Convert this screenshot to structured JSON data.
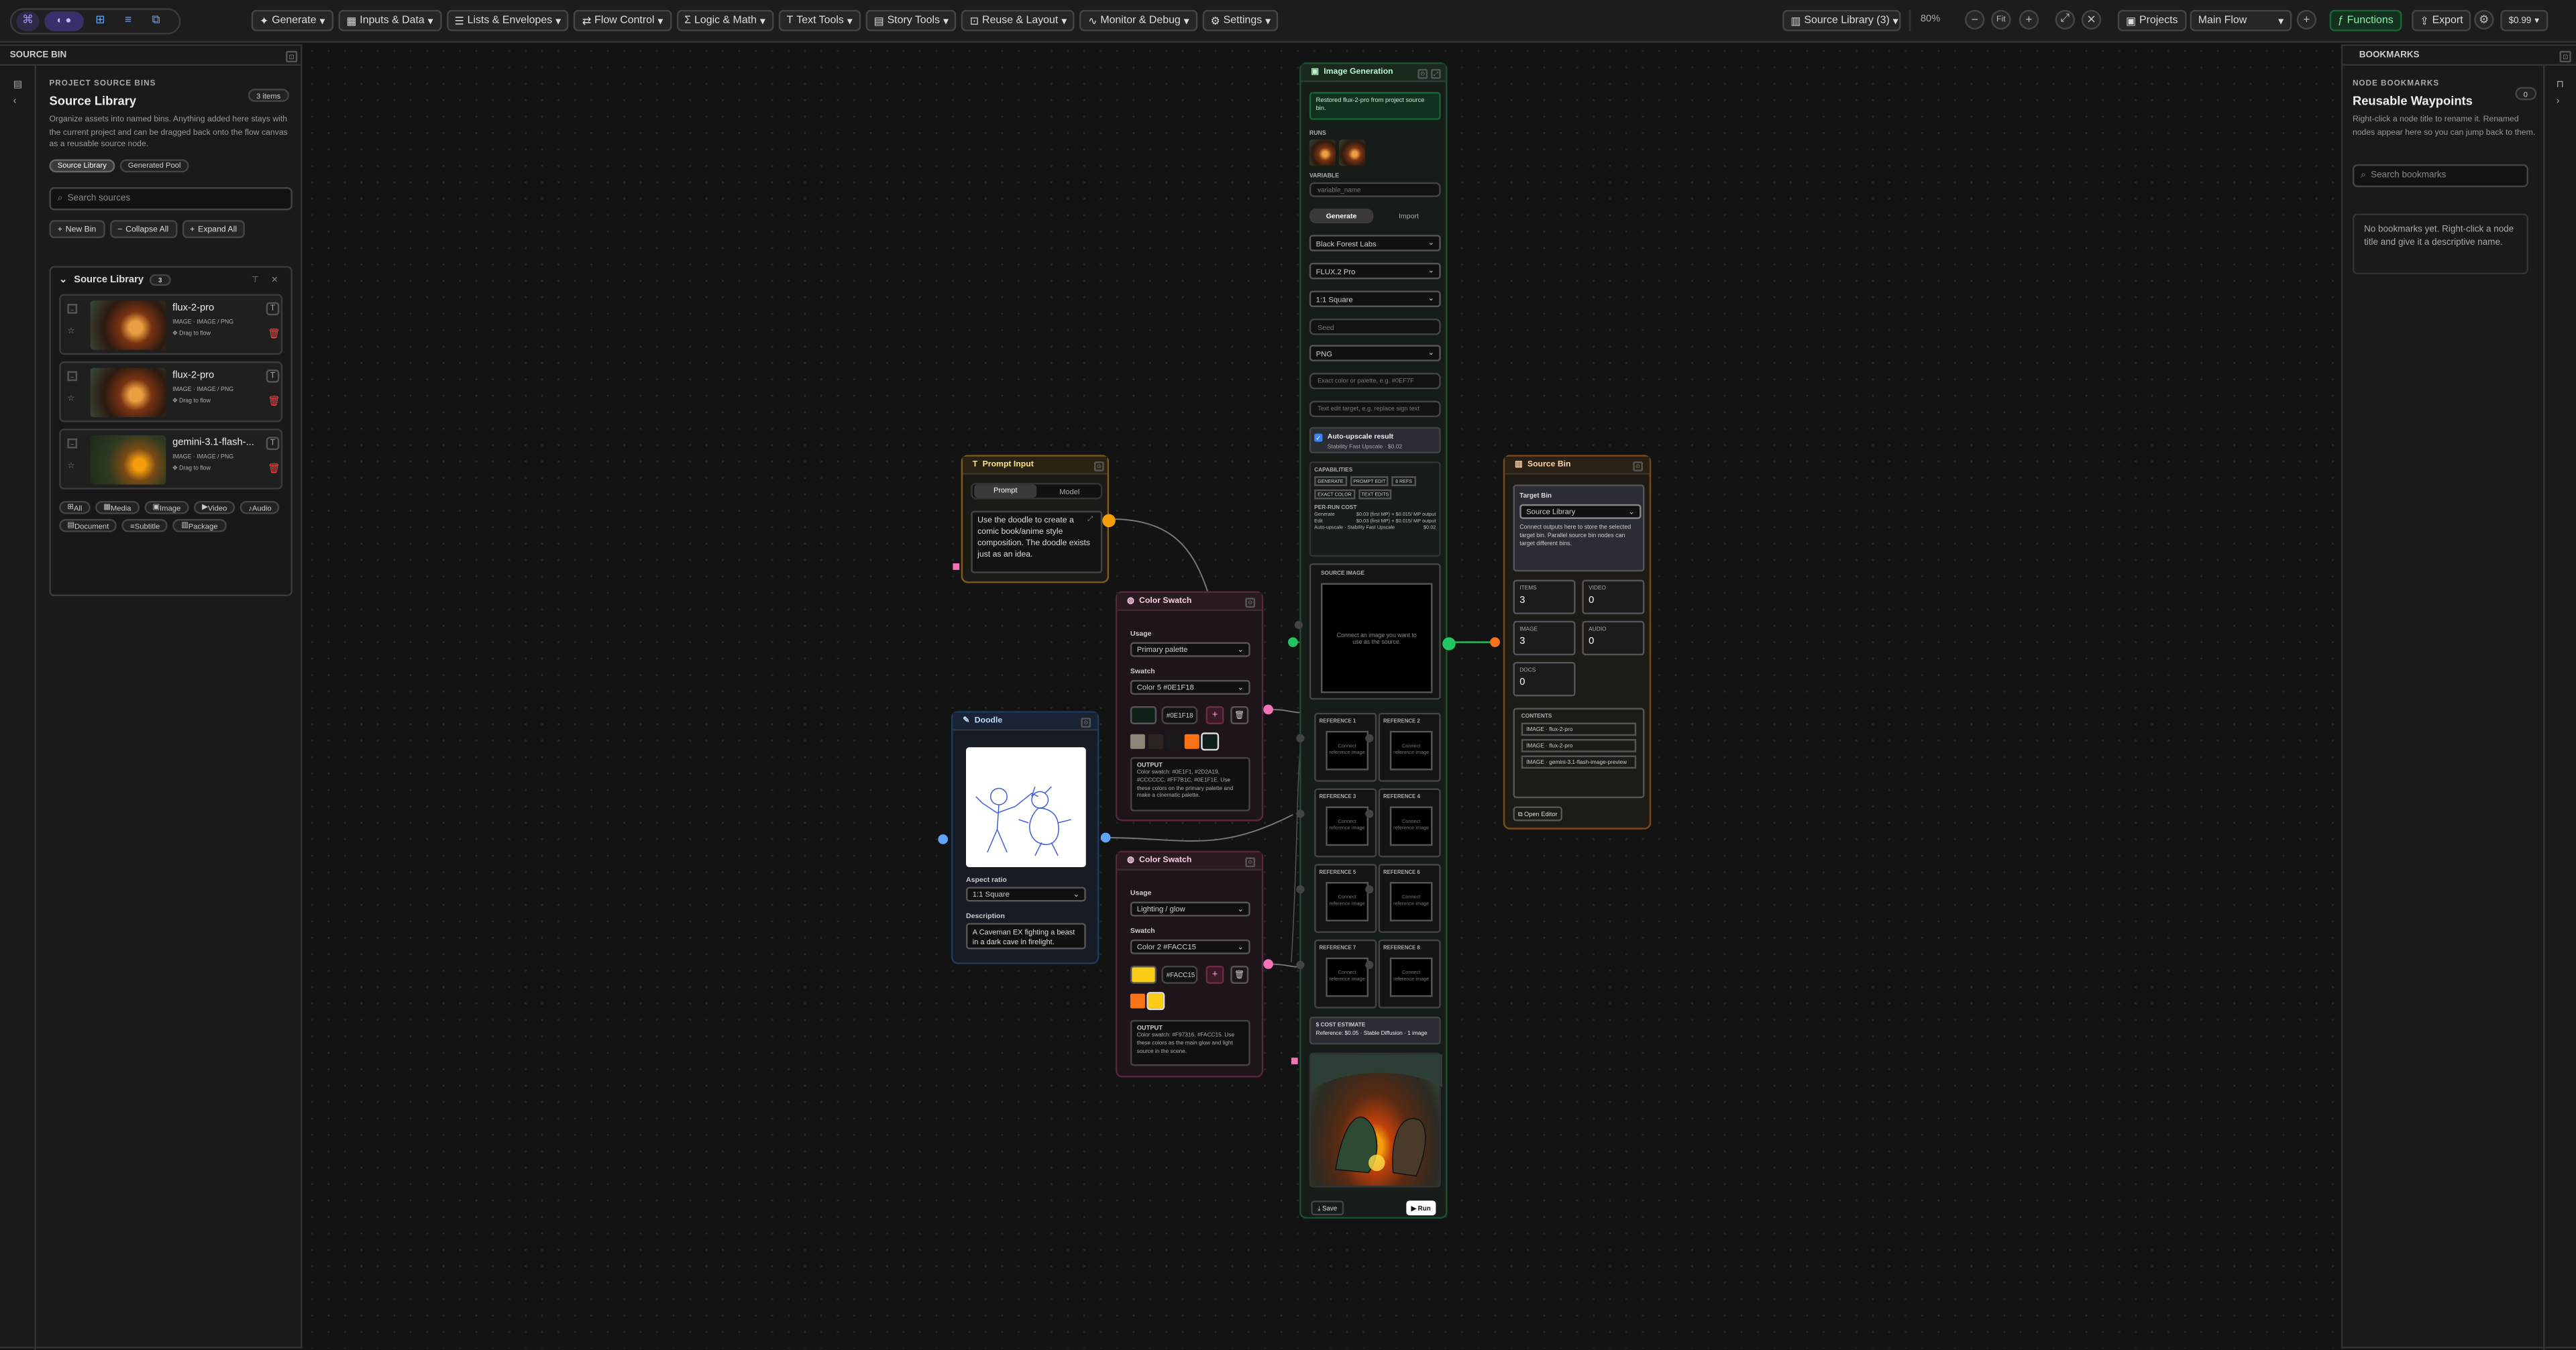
{
  "toolbar": {
    "menus": [
      "Generate",
      "Inputs & Data",
      "Lists & Envelopes",
      "Flow Control",
      "Logic & Math",
      "Text Tools",
      "Story Tools",
      "Reuse & Layout",
      "Monitor & Debug",
      "Settings"
    ],
    "bin_select": "Source Library (3)",
    "zoom": "80%",
    "fit": "Fit",
    "projects": "Projects",
    "flow": "Main Flow",
    "functions": "Functions",
    "export": "Export",
    "credits": "$0.99"
  },
  "left": {
    "header": "SOURCE BIN",
    "caption": "PROJECT SOURCE BINS",
    "title": "Source Library",
    "count": "3 items",
    "desc": "Organize assets into named bins. Anything added here stays with the current project and can be dragged back onto the flow canvas as a reusable source node.",
    "tabs": [
      "Source Library",
      "Generated Pool"
    ],
    "search_ph": "Search sources",
    "buttons": [
      "New Bin",
      "Collapse All",
      "Expand All"
    ],
    "bin_name": "Source Library",
    "bin_count": "3",
    "items": [
      {
        "name": "flux-2-pro",
        "meta": "IMAGE · IMAGE / PNG",
        "drag": "Drag to flow"
      },
      {
        "name": "flux-2-pro",
        "meta": "IMAGE · IMAGE / PNG",
        "drag": "Drag to flow"
      },
      {
        "name": "gemini-3.1-flash-...",
        "meta": "IMAGE · IMAGE / PNG",
        "drag": "Drag to flow"
      }
    ],
    "filters": [
      "All",
      "Media",
      "Image",
      "Video",
      "Audio",
      "Document",
      "Subtitle",
      "Package"
    ]
  },
  "right": {
    "header": "BOOKMARKS",
    "caption": "NODE BOOKMARKS",
    "title": "Reusable Waypoints",
    "count": "0",
    "desc": "Right-click a node title to rename it. Renamed nodes appear here so you can jump back to them.",
    "search_ph": "Search bookmarks",
    "empty": "No bookmarks yet. Right-click a node title and give it a descriptive name."
  },
  "prompt_node": {
    "title": "Prompt Input",
    "tabs": [
      "Prompt",
      "Model"
    ],
    "text": "Use the doodle to create a comic book/anime style composition. The doodle exists just as an idea."
  },
  "doodle": {
    "title": "Doodle",
    "aspect_label": "Aspect ratio",
    "aspect": "1:1 Square",
    "desc_label": "Description",
    "desc": "A Caveman EX fighting a beast in a dark cave in firelight."
  },
  "swatch1": {
    "title": "Color Swatch",
    "usage_label": "Usage",
    "usage": "Primary palette",
    "swatch_label": "Swatch",
    "swatch": "Color 5 #0E1F18",
    "hex": "#0E1F18",
    "output_label": "OUTPUT",
    "output": "Color swatch: #0E1F1, #2D2A19, #CCCCCC, #FF7B1C, #0E1F1E. Use these colors on the primary palette and make a cinematic palette."
  },
  "swatch2": {
    "title": "Color Swatch",
    "usage_label": "Usage",
    "usage": "Lighting / glow",
    "swatch_label": "Swatch",
    "swatch": "Color 2 #FACC15",
    "hex": "#FACC15",
    "output_label": "OUTPUT",
    "output": "Color swatch: #F97316, #FACC15. Use these colors as the main glow and light source in the scene."
  },
  "gen": {
    "title": "Image Generation",
    "notice": "Restored flux-2-pro from project source bin.",
    "runs_label": "RUNS",
    "variable_label": "VARIABLE",
    "variable_ph": "variable_name",
    "tabs": [
      "Generate",
      "Import"
    ],
    "provider": "Black Forest Labs",
    "model": "FLUX.2 Pro",
    "ratio": "1:1 Square",
    "seed_ph": "Seed",
    "format": "PNG",
    "palette_ph": "Exact color or palette, e.g. #0EF7F",
    "edit_ph": "Text edit target, e.g. replace sign text",
    "upscale": "Auto-upscale result",
    "upscale_sub": "Stability Fast Upscale · $0.02",
    "cap_label": "CAPABILITIES",
    "caps": [
      "GENERATE",
      "PROMPT EDIT",
      "8 REFS",
      "EXACT COLOR",
      "TEXT EDITS"
    ],
    "pricing_label": "PER-RUN COST",
    "pricing": [
      [
        "Generate",
        "$0.03 (first MP) + $0.015/ MP output"
      ],
      [
        "Edit",
        "$0.03 (first MP) + $0.015/ MP output"
      ],
      [
        "Auto-upscale · Stability Fast Upscale",
        "$0.02"
      ]
    ],
    "source_label": "SOURCE IMAGE",
    "source": "Connect an image you want to use as the source.",
    "refs": [
      "REFERENCE 1",
      "REFERENCE 2",
      "REFERENCE 3",
      "REFERENCE 4",
      "REFERENCE 5",
      "REFERENCE 6",
      "REFERENCE 7",
      "REFERENCE 8"
    ],
    "ref_text": "Connect reference image",
    "cost_label": "COST ESTIMATE",
    "cost": "Reference: $0.05 · Stable Diffusion · 1 image",
    "save": "Save",
    "run": "Run"
  },
  "srcbin": {
    "title": "Source Bin",
    "target_label": "Target Bin",
    "target": "Source Library",
    "desc": "Connect outputs here to store the selected target bin. Parallel source bin nodes can target different bins.",
    "stats": [
      [
        "ITEMS",
        "3"
      ],
      [
        "VIDEO",
        "0"
      ],
      [
        "IMAGE",
        "3"
      ],
      [
        "AUDIO",
        "0"
      ],
      [
        "DOCS",
        "0"
      ]
    ],
    "contents_label": "CONTENTS",
    "contents": [
      "IMAGE · flux-2-pro",
      "IMAGE · flux-2-pro",
      "IMAGE · gemini-3.1-flash-image-preview"
    ],
    "open": "Open Editor"
  },
  "colors": {
    "accent": "#8b5cf6",
    "green": "#22c55e",
    "orange": "#f59e0b",
    "pink": "#f472b6",
    "blue": "#60a5fa",
    "swatches1": [
      "#0E1F18",
      "#8a8577",
      "#2a2520",
      "#1a1a1a",
      "#F97316",
      "#0E1F1E"
    ],
    "swatches2": [
      "#F97316",
      "#FACC15"
    ]
  }
}
